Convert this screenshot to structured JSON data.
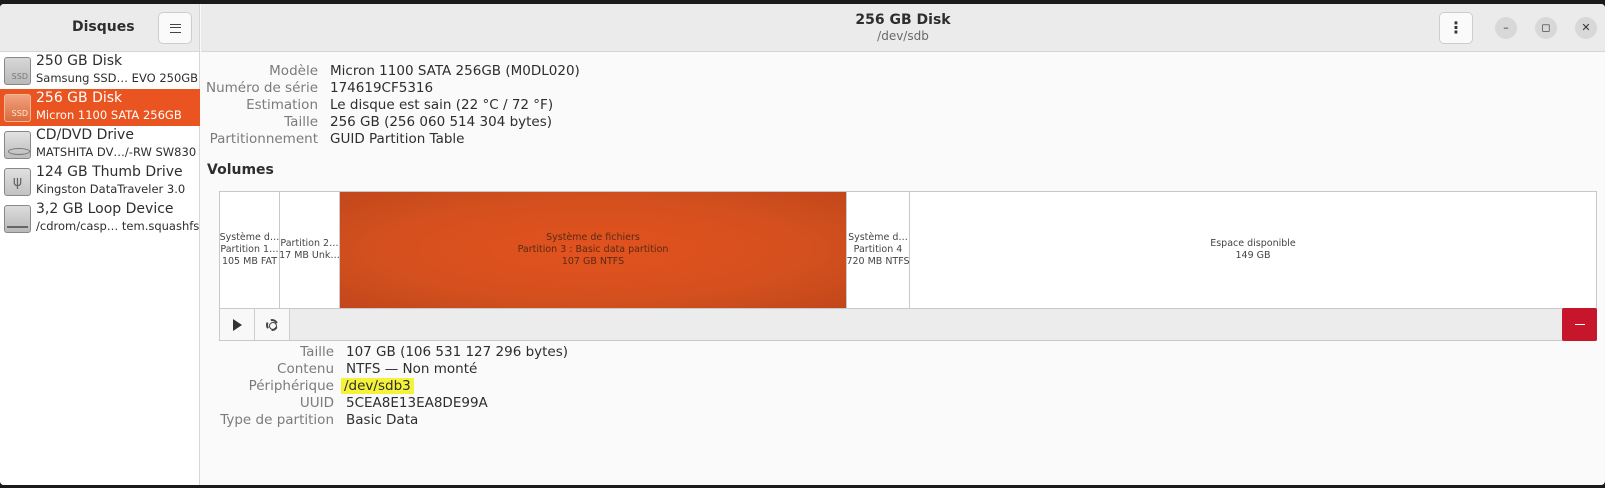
{
  "sidebar": {
    "title": "Disques",
    "devices": [
      {
        "name": "250 GB Disk",
        "sub": "Samsung SSD…  EVO 250GB",
        "icon": "ssd-icon",
        "icon_text": "SSD"
      },
      {
        "name": "256 GB Disk",
        "sub": "Micron 1100 SATA 256GB",
        "icon": "ssd-icon",
        "icon_text": "SSD",
        "selected": true
      },
      {
        "name": "CD/DVD Drive",
        "sub": "MATSHITA DV…/-RW SW830",
        "icon": "optical-drive-icon"
      },
      {
        "name": "124 GB Thumb Drive",
        "sub": "Kingston DataTraveler 3.0",
        "icon": "usb-drive-icon",
        "icon_text": "ψ"
      },
      {
        "name": "3,2 GB Loop Device",
        "sub": "/cdrom/casp…  tem.squashfs",
        "icon": "loop-device-icon"
      }
    ]
  },
  "header": {
    "title": "256 GB Disk",
    "subtitle": "/dev/sdb",
    "kebab": "⋮",
    "minimize": "–",
    "maximize": "◻",
    "close": "✕"
  },
  "disk_info": [
    {
      "label": "Modèle",
      "value": "Micron 1100 SATA 256GB (M0DL020)"
    },
    {
      "label": "Numéro de série",
      "value": "174619CF5316"
    },
    {
      "label": "Estimation",
      "value": "Le disque est sain (22 °C / 72 °F)"
    },
    {
      "label": "Taille",
      "value": "256 GB (256 060 514 304 bytes)"
    },
    {
      "label": "Partitionnement",
      "value": "GUID Partition Table"
    }
  ],
  "volumes_title": "Volumes",
  "partitions": [
    {
      "line1": "Système d…",
      "line2": "Partition 1…",
      "line3": "105 MB FAT"
    },
    {
      "line1": "Partition 2…",
      "line2": "17 MB Unk…"
    },
    {
      "line1": "Système de fichiers",
      "line2": "Partition 3 : Basic data partition",
      "line3": "107 GB NTFS",
      "selected": true
    },
    {
      "line1": "Système d…",
      "line2": "Partition 4",
      "line3": "720 MB NTFS"
    },
    {
      "line1": "Espace disponible",
      "line2": "149 GB"
    }
  ],
  "partition_info": [
    {
      "label": "Taille",
      "value": "107 GB (106 531 127 296 bytes)"
    },
    {
      "label": "Contenu",
      "value": "NTFS — Non monté"
    },
    {
      "label": "Périphérique",
      "value": "/dev/sdb3",
      "highlighted": true
    },
    {
      "label": "UUID",
      "value": "5CEA8E13EA8DE99A"
    },
    {
      "label": "Type de partition",
      "value": "Basic Data"
    }
  ],
  "colors": {
    "accent": "#e95420",
    "danger": "#c7162b",
    "highlight": "#f5f23a"
  }
}
